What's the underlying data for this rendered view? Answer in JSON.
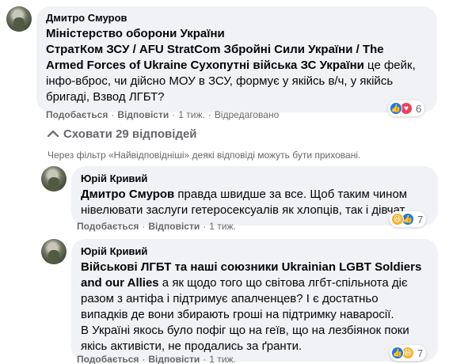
{
  "comment1": {
    "author": "Дмитро Смуров",
    "tag": "Міністерство оборони України СтратКом ЗСУ / AFU StratCom Збройні Сили України / The Armed Forces of Ukraine Сухопутні війська ЗС України",
    "text_after_tag": " це фейк, інфо-вброс, чи дійсно МОУ в ЗСУ, формує у якійсь в/ч, у якійсь бригаді, Взвод ЛГБТ?",
    "lines": [
      {
        "bold": "Міністерство оборони України",
        "normal": ""
      },
      {
        "bold": "СтратКом ЗСУ / AFU StratCom Збройні Сили України / The",
        "normal": ""
      },
      {
        "bold": "Armed Forces of Ukraine Сухопутні війська ЗС України",
        "normal": " це фейк,"
      },
      {
        "bold": "",
        "normal": "інфо-вброс, чи дійсно МОУ в ЗСУ, формує у якійсь в/ч, у якійсь"
      },
      {
        "bold": "",
        "normal": "бригаді, Взвод ЛГБТ?"
      }
    ],
    "reaction_count": "6",
    "actions": {
      "like": "Подобається",
      "reply": "Відповісти",
      "time": "1 тиж.",
      "edited": "Відредаговано"
    }
  },
  "hide_replies": "Сховати 29 відповідей",
  "filter_note": "Через фільтр «Найвідповідніші» деякі відповіді можуть бути приховані.",
  "reply1": {
    "author": "Юрій Кривий",
    "lines": [
      {
        "bold": "Дмитро Смуров",
        "normal": " правда швидше за все. Щоб таким чином"
      },
      {
        "bold": "",
        "normal": "нівелювати заслуги гетеросексуалів як хлопців, так і дівчат."
      }
    ],
    "reaction_count": "7",
    "actions": {
      "like": "Подобається",
      "reply": "Відповісти",
      "time": "1 тиж."
    }
  },
  "reply2": {
    "author": "Юрій Кривий",
    "lines": [
      {
        "bold": "Військові ЛГБТ та наші союзники Ukrainian LGBT Soldiers",
        "normal": ""
      },
      {
        "bold": "and our Allies",
        "normal": " а як щодо того що світова лгбт-спільнота діє"
      },
      {
        "bold": "",
        "normal": "разом з антіфа і підтримує апалченцев? І є достатньо"
      },
      {
        "bold": "",
        "normal": "випадків де вони збирають гроші на підтримку наваросії."
      },
      {
        "bold": "",
        "normal": "В Україні якось було пофіг що на геїв, що на лезбіянок поки"
      },
      {
        "bold": "",
        "normal": "якісь активісти, не продались за ґранти."
      }
    ],
    "reaction_count": "7",
    "actions": {
      "like": "Подобається",
      "reply": "Відповісти",
      "time": "1 тиж."
    }
  },
  "colors": {
    "bubble": "#f0f2f5",
    "meta": "#65676b",
    "like": "#1877f2",
    "love": "#f33e58",
    "haha": "#f7b125"
  }
}
